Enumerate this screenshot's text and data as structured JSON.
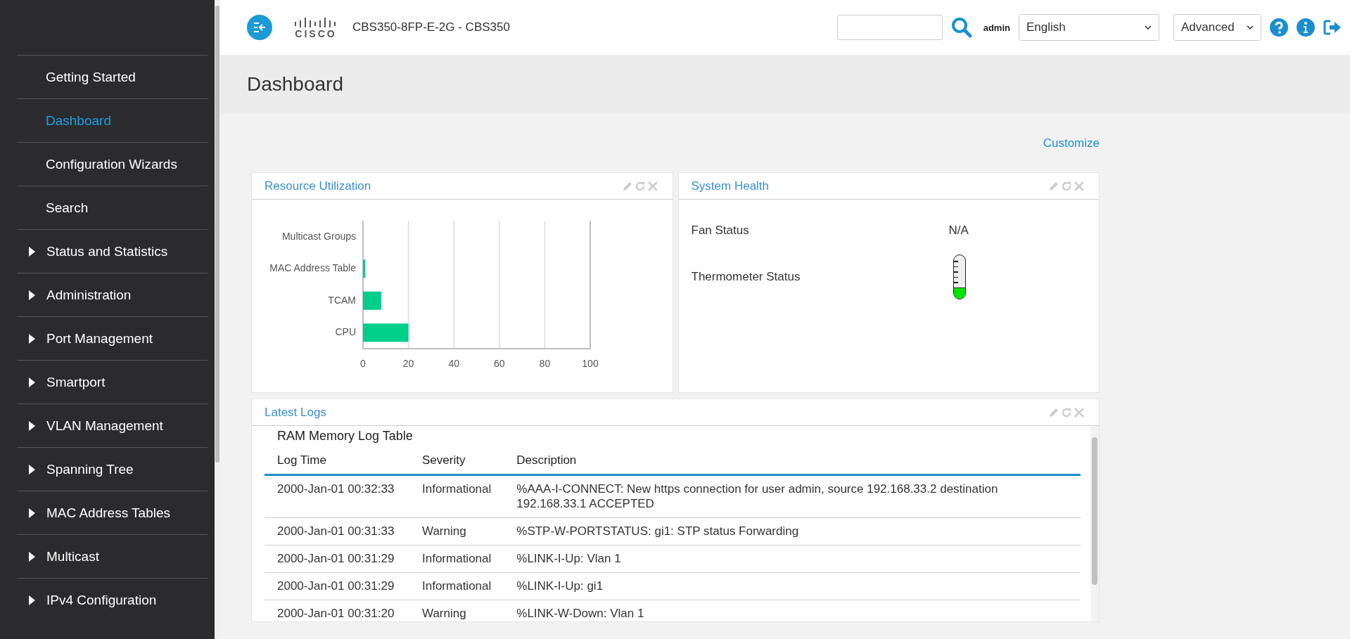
{
  "sidebar": {
    "items": [
      {
        "label": "Getting Started",
        "kind": "link",
        "selected": false
      },
      {
        "label": "Dashboard",
        "kind": "link",
        "selected": true
      },
      {
        "label": "Configuration Wizards",
        "kind": "link",
        "selected": false
      },
      {
        "label": "Search",
        "kind": "link",
        "selected": false
      },
      {
        "label": "Status and Statistics",
        "kind": "group",
        "selected": false
      },
      {
        "label": "Administration",
        "kind": "group",
        "selected": false
      },
      {
        "label": "Port Management",
        "kind": "group",
        "selected": false
      },
      {
        "label": "Smartport",
        "kind": "group",
        "selected": false
      },
      {
        "label": "VLAN Management",
        "kind": "group",
        "selected": false
      },
      {
        "label": "Spanning Tree",
        "kind": "group",
        "selected": false
      },
      {
        "label": "MAC Address Tables",
        "kind": "group",
        "selected": false
      },
      {
        "label": "Multicast",
        "kind": "group",
        "selected": false
      },
      {
        "label": "IPv4 Configuration",
        "kind": "group",
        "selected": false
      }
    ]
  },
  "header": {
    "logo_text": "CISCO",
    "device": "CBS350-8FP-E-2G - CBS350",
    "user": "admin",
    "language": "English",
    "mode": "Advanced"
  },
  "page": {
    "title": "Dashboard",
    "customize": "Customize"
  },
  "resource_utilization": {
    "title": "Resource Utilization",
    "chart_data": {
      "type": "bar",
      "orientation": "horizontal",
      "categories": [
        "Multicast Groups",
        "MAC Address Table",
        "TCAM",
        "CPU"
      ],
      "values": [
        0,
        1,
        8,
        20
      ],
      "xlim": [
        0,
        100
      ],
      "grid": true,
      "xticks": [
        0,
        20,
        40,
        60,
        80,
        100
      ]
    }
  },
  "system_health": {
    "title": "System Health",
    "fan_label": "Fan Status",
    "fan_value": "N/A",
    "thermo_label": "Thermometer Status",
    "thermometer": {
      "level": 0.25
    }
  },
  "logs": {
    "title": "Latest Logs",
    "table_title": "RAM Memory Log Table",
    "columns": [
      "Log Time",
      "Severity",
      "Description"
    ],
    "rows": [
      [
        "2000-Jan-01 00:32:33",
        "Informational",
        "%AAA-I-CONNECT: New https connection for user admin, source 192.168.33.2 destination 192.168.33.1 ACCEPTED"
      ],
      [
        "2000-Jan-01 00:31:33",
        "Warning",
        "%STP-W-PORTSTATUS: gi1: STP status Forwarding"
      ],
      [
        "2000-Jan-01 00:31:29",
        "Informational",
        "%LINK-I-Up: Vlan 1"
      ],
      [
        "2000-Jan-01 00:31:29",
        "Informational",
        "%LINK-I-Up: gi1"
      ],
      [
        "2000-Jan-01 00:31:20",
        "Warning",
        "%LINK-W-Down: Vlan 1"
      ]
    ]
  }
}
